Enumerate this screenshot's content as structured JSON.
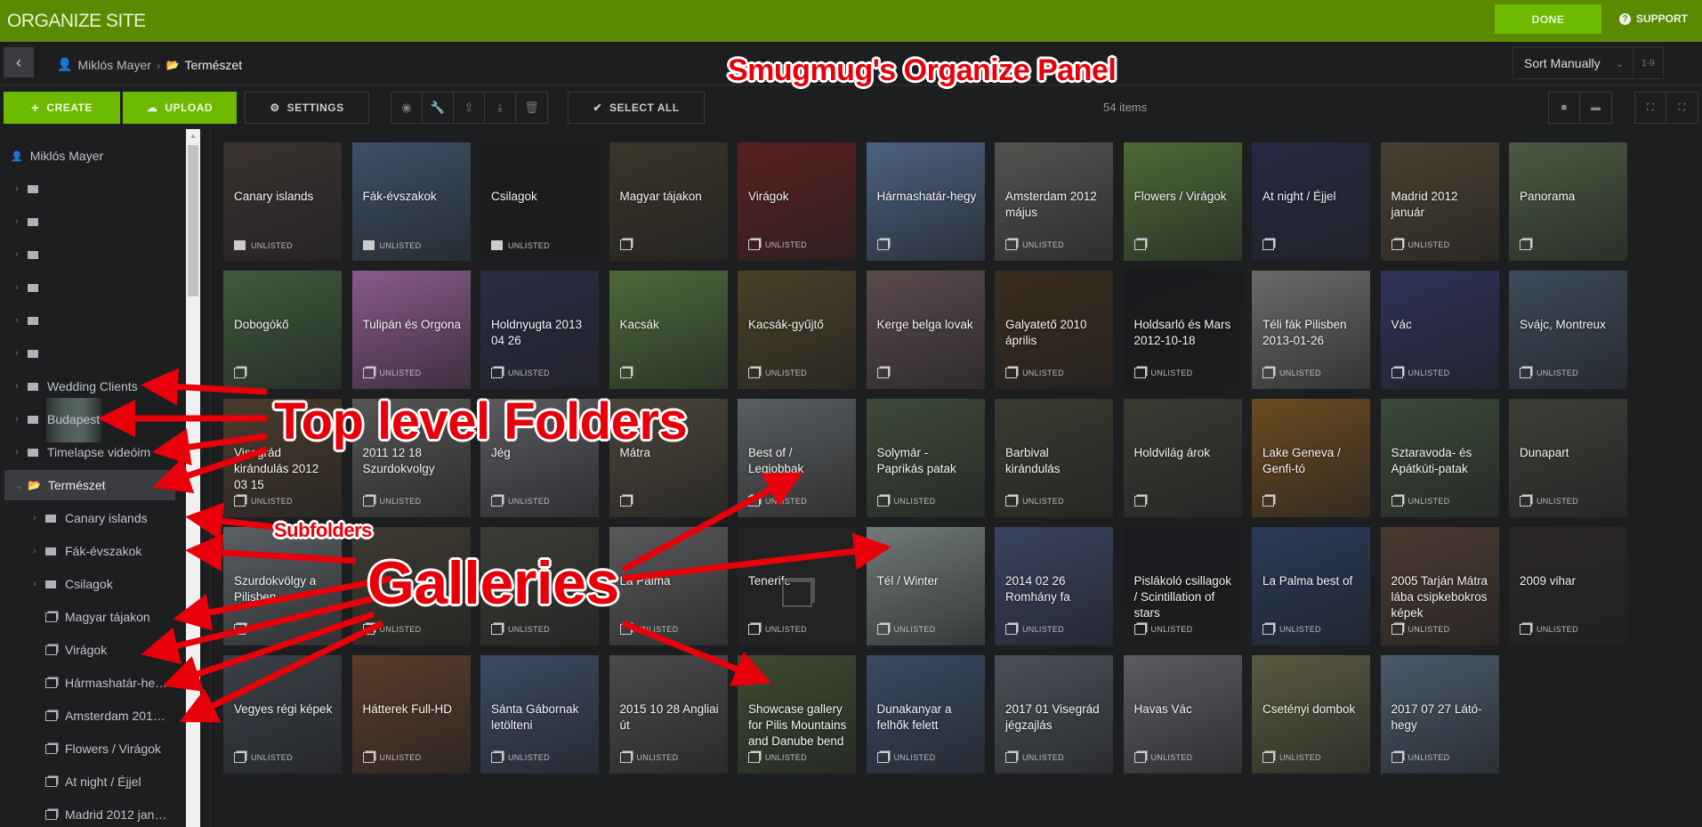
{
  "header": {
    "title": "ORGANIZE SITE",
    "done_label": "DONE",
    "support_label": "SUPPORT"
  },
  "breadcrumb": {
    "user": "Miklós Mayer",
    "separator": "›",
    "current": "Természet"
  },
  "sort": {
    "selected": "Sort Manually",
    "range_label": "1-9"
  },
  "toolbar": {
    "create_label": "CREATE",
    "upload_label": "UPLOAD",
    "settings_label": "SETTINGS",
    "select_all_label": "SELECT ALL",
    "item_count": "54 items"
  },
  "sidebar": {
    "root": "Miklós Mayer",
    "items": [
      {
        "label": "",
        "type": "folder",
        "expandable": true
      },
      {
        "label": "",
        "type": "folder",
        "expandable": true
      },
      {
        "label": "",
        "type": "folder",
        "expandable": true
      },
      {
        "label": "",
        "type": "folder",
        "expandable": true
      },
      {
        "label": "",
        "type": "folder",
        "expandable": true
      },
      {
        "label": "",
        "type": "folder",
        "expandable": true
      },
      {
        "label": "Wedding Clients",
        "type": "folder",
        "expandable": true
      },
      {
        "label": "Budapest",
        "type": "folder",
        "expandable": true
      },
      {
        "label": "Timelapse videóim",
        "type": "folder",
        "expandable": true
      },
      {
        "label": "Természet",
        "type": "folder-open",
        "expandable": true,
        "selected": true
      },
      {
        "label": "Canary islands",
        "type": "folder",
        "expandable": true,
        "level": 1
      },
      {
        "label": "Fák-évszakok",
        "type": "folder",
        "expandable": true,
        "level": 1
      },
      {
        "label": "Csilagok",
        "type": "folder",
        "expandable": true,
        "level": 1
      },
      {
        "label": "Magyar tájakon",
        "type": "gallery",
        "level": 1
      },
      {
        "label": "Virágok",
        "type": "gallery",
        "level": 1
      },
      {
        "label": "Hármashatár-he…",
        "type": "gallery",
        "level": 1
      },
      {
        "label": "Amsterdam 201…",
        "type": "gallery",
        "level": 1
      },
      {
        "label": "Flowers / Virágok",
        "type": "gallery",
        "level": 1
      },
      {
        "label": "At night / Éjjel",
        "type": "gallery",
        "level": 1
      },
      {
        "label": "Madrid 2012 jan…",
        "type": "gallery",
        "level": 1
      }
    ]
  },
  "grid": {
    "unlisted_label": "UNLISTED",
    "items": [
      {
        "title": "Canary islands",
        "type": "folder",
        "unlisted": true,
        "color": "#3a3230"
      },
      {
        "title": "Fák-évszakok",
        "type": "folder",
        "unlisted": true,
        "color": "#3d5066"
      },
      {
        "title": "Csilagok",
        "type": "folder",
        "unlisted": true,
        "color": "#1c1c1e"
      },
      {
        "title": "Magyar tájakon",
        "type": "gallery",
        "unlisted": false,
        "color": "#3a3528"
      },
      {
        "title": "Virágok",
        "type": "gallery",
        "unlisted": true,
        "color": "#5a2020"
      },
      {
        "title": "Hármashatár-hegy",
        "type": "gallery",
        "unlisted": false,
        "color": "#4c6180"
      },
      {
        "title": "Amsterdam 2012 május",
        "type": "gallery",
        "unlisted": true,
        "color": "#555350"
      },
      {
        "title": "Flowers / Virágok",
        "type": "gallery",
        "unlisted": false,
        "color": "#4d6a35"
      },
      {
        "title": "At night / Éjjel",
        "type": "gallery",
        "unlisted": false,
        "color": "#262a42"
      },
      {
        "title": "Madrid 2012 január",
        "type": "gallery",
        "unlisted": true,
        "color": "#4a4030"
      },
      {
        "title": "Panorama",
        "type": "gallery",
        "unlisted": false,
        "color": "#4a5a40"
      },
      {
        "title": "Dobogókő",
        "type": "gallery",
        "unlisted": false,
        "color": "#3f5a3a"
      },
      {
        "title": "Tulipán és Orgona",
        "type": "gallery",
        "unlisted": true,
        "color": "#8a5a8a"
      },
      {
        "title": "Holdnyugta 2013 04 26",
        "type": "gallery",
        "unlisted": true,
        "color": "#2a2d45"
      },
      {
        "title": "Kacsák",
        "type": "gallery",
        "unlisted": false,
        "color": "#4d6a3a"
      },
      {
        "title": "Kacsák-gyűjtő",
        "type": "gallery",
        "unlisted": true,
        "color": "#4a4028"
      },
      {
        "title": "Kerge belga lovak",
        "type": "gallery",
        "unlisted": false,
        "color": "#5a4a4c"
      },
      {
        "title": "Galyatető 2010 április",
        "type": "gallery",
        "unlisted": true,
        "color": "#3a2c1e"
      },
      {
        "title": "Holdsarló és Mars 2012-10-18",
        "type": "gallery",
        "unlisted": true,
        "color": "#1a1a1e"
      },
      {
        "title": "Téli fák Pilisben 2013-01-26",
        "type": "gallery",
        "unlisted": true,
        "color": "#6a6a6a"
      },
      {
        "title": "Vác",
        "type": "gallery",
        "unlisted": true,
        "color": "#2e3258"
      },
      {
        "title": "Svájc, Montreux",
        "type": "gallery",
        "unlisted": true,
        "color": "#3d4a5a"
      },
      {
        "title": "Visegrád kirándulás 2012 03 15",
        "type": "gallery",
        "unlisted": true,
        "color": "#4a3c2c"
      },
      {
        "title": "2011 12 18 Szurdokvolgy",
        "type": "gallery",
        "unlisted": true,
        "color": "#555555"
      },
      {
        "title": "Jég",
        "type": "gallery",
        "unlisted": true,
        "color": "#5a5a60"
      },
      {
        "title": "Mátra",
        "type": "gallery",
        "unlisted": false,
        "color": "#4a4538"
      },
      {
        "title": "Best of / Legjobbak",
        "type": "gallery",
        "unlisted": true,
        "color": "#5a5e60"
      },
      {
        "title": "Solymár - Paprikás patak",
        "type": "gallery",
        "unlisted": true,
        "color": "#3e4a38"
      },
      {
        "title": "Barbival kirándulás",
        "type": "gallery",
        "unlisted": true,
        "color": "#3a3a30"
      },
      {
        "title": "Holdvilág árok",
        "type": "gallery",
        "unlisted": false,
        "color": "#3a3a32"
      },
      {
        "title": "Lake Geneva / Genfi-tó",
        "type": "gallery",
        "unlisted": false,
        "color": "#6a4a20"
      },
      {
        "title": "Sztaravoda- és Apátkúti-patak",
        "type": "gallery",
        "unlisted": true,
        "color": "#3a4a38"
      },
      {
        "title": "Dunapart",
        "type": "gallery",
        "unlisted": true,
        "color": "#3c3e36"
      },
      {
        "title": "Szurdokvölgy a Pilisben",
        "type": "gallery",
        "unlisted": false,
        "color": "#5a6064"
      },
      {
        "title": "",
        "type": "gallery",
        "unlisted": true,
        "color": "#3d3a30"
      },
      {
        "title": "",
        "type": "gallery",
        "unlisted": true,
        "color": "#3a3c34"
      },
      {
        "title": "La Palma",
        "type": "gallery",
        "unlisted": true,
        "color": "#5a5a5c"
      },
      {
        "title": "Tenerife",
        "type": "gallery",
        "unlisted": true,
        "color": "#222325",
        "empty": true
      },
      {
        "title": "Tél / Winter",
        "type": "gallery",
        "unlisted": true,
        "color": "#707a78"
      },
      {
        "title": "2014 02 26 Romhány fa",
        "type": "gallery",
        "unlisted": true,
        "color": "#3a4460"
      },
      {
        "title": "Pislákoló csillagok / Scintillation of stars",
        "type": "gallery",
        "unlisted": true,
        "color": "#1c1c20"
      },
      {
        "title": "La Palma best of",
        "type": "gallery",
        "unlisted": true,
        "color": "#2a3a58"
      },
      {
        "title": "2005 Tarján Mátra lába csipkebokros képek",
        "type": "gallery",
        "unlisted": true,
        "color": "#4a3a30"
      },
      {
        "title": "2009 vihar",
        "type": "gallery",
        "unlisted": true,
        "color": "#2a2626"
      },
      {
        "title": "Vegyes régi képek",
        "type": "gallery",
        "unlisted": true,
        "color": "#3a4048"
      },
      {
        "title": "Hátterek Full-HD",
        "type": "gallery",
        "unlisted": true,
        "color": "#5a3c2a"
      },
      {
        "title": "Sánta Gábornak letölteni",
        "type": "gallery",
        "unlisted": true,
        "color": "#3c4a62"
      },
      {
        "title": "2015 10 28 Angliai út",
        "type": "gallery",
        "unlisted": true,
        "color": "#4a4a4c"
      },
      {
        "title": "Showcase gallery for Pilis Mountains and Danube bend",
        "type": "gallery",
        "unlisted": true,
        "color": "#3e4a30"
      },
      {
        "title": "Dunakanyar a felhők felett",
        "type": "gallery",
        "unlisted": true,
        "color": "#3a4a62"
      },
      {
        "title": "2017 01 Visegrád jégzajlás",
        "type": "gallery",
        "unlisted": true,
        "color": "#4a5058"
      },
      {
        "title": "Havas Vác",
        "type": "gallery",
        "unlisted": true,
        "color": "#5a5c60"
      },
      {
        "title": "Csetényi dombok",
        "type": "gallery",
        "unlisted": true,
        "color": "#5a5a40"
      },
      {
        "title": "2017 07 27 Látó-hegy",
        "type": "gallery",
        "unlisted": true,
        "color": "#4a5a6a"
      }
    ]
  },
  "annotations": {
    "panel": "Smugmug's Organize Panel",
    "top_folders": "Top level Folders",
    "subfolders": "Subfolders",
    "galleries": "Galleries"
  },
  "colors": {
    "header": "#5a8a00",
    "accent": "#6dba00",
    "background": "#1d1e20",
    "annotation": "#e8000a"
  }
}
